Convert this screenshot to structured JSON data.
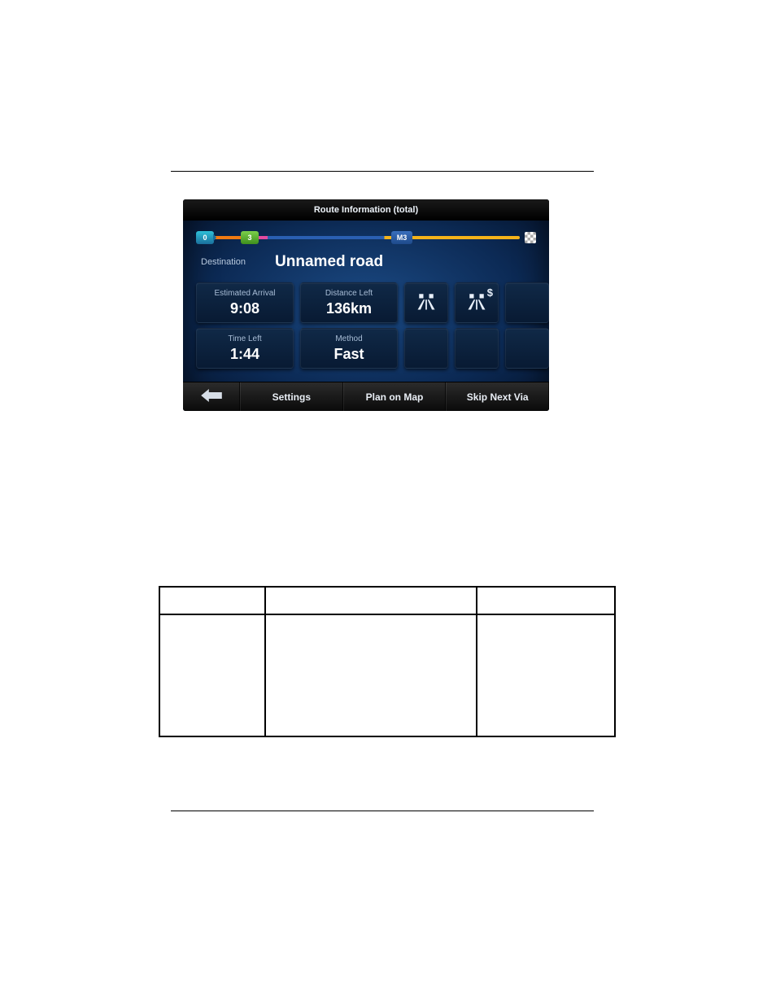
{
  "gps": {
    "title": "Route Information (total)",
    "timeline": {
      "start_badge": "0",
      "left_badge": "3",
      "mid_badge": "M3"
    },
    "destination_label": "Destination",
    "destination_value": "Unnamed road",
    "tiles": {
      "eta_label": "Estimated Arrival",
      "eta_value": "9:08",
      "distance_label": "Distance Left",
      "distance_value": "136km",
      "timeleft_label": "Time Left",
      "timeleft_value": "1:44",
      "method_label": "Method",
      "method_value": "Fast",
      "toll_symbol": "$"
    },
    "bottombar": {
      "settings": "Settings",
      "plan_on_map": "Plan on Map",
      "skip_next_via": "Skip Next Via"
    }
  }
}
